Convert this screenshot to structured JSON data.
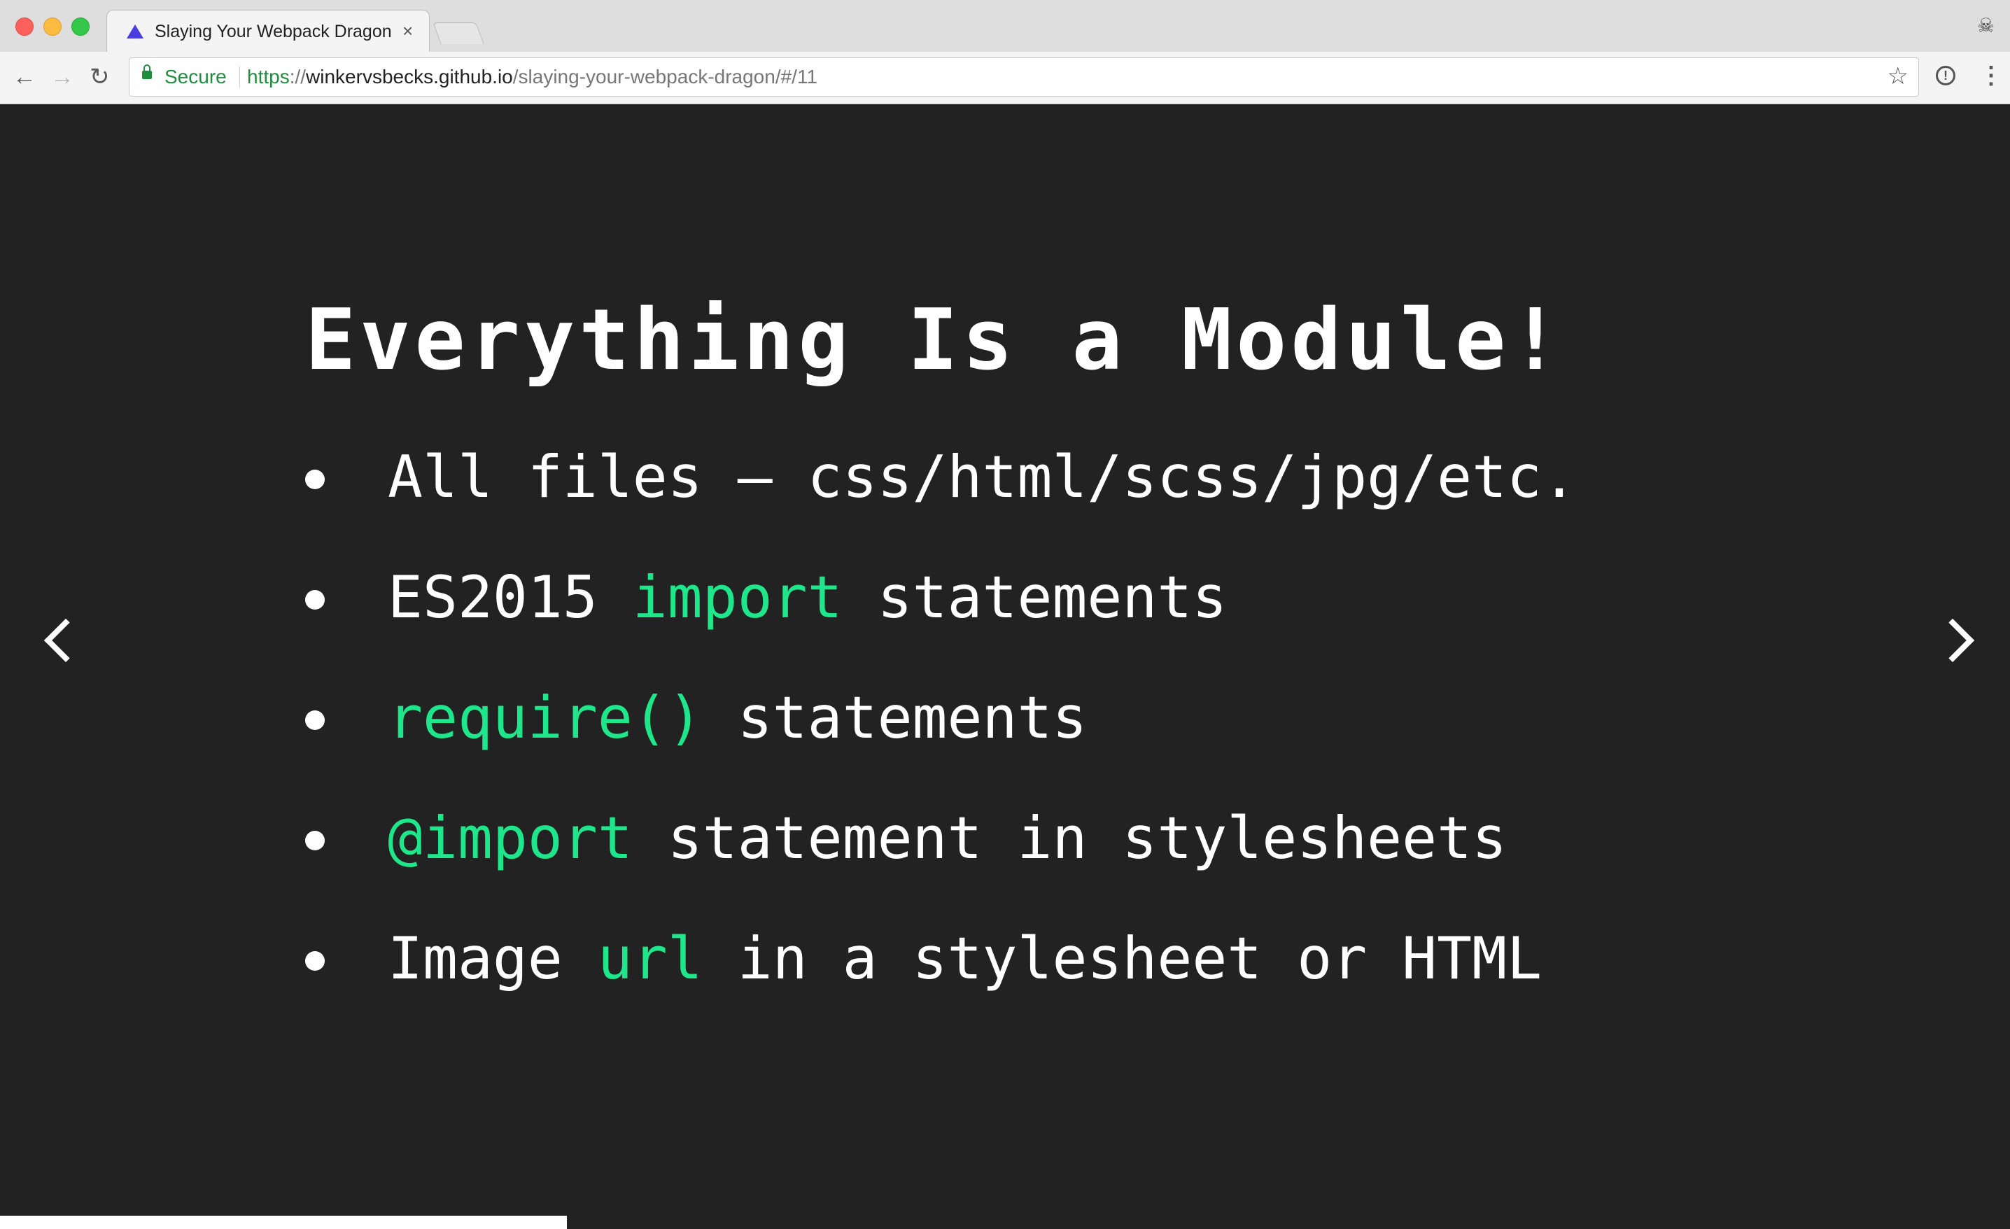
{
  "browser": {
    "tab_title": "Slaying Your Webpack Dragon",
    "tab_close": "×",
    "security_label": "Secure",
    "url": {
      "scheme": "https",
      "separator": "://",
      "host": "winkervsbecks.github.io",
      "path": "/slaying-your-webpack-dragon/#/11"
    },
    "icons": {
      "tab_favicon": "triangle-icon",
      "profile": "incognito-icon",
      "back": "arrow-left-icon",
      "forward": "arrow-right-icon",
      "reload": "reload-icon",
      "secure": "lock-icon",
      "bookmark": "star-icon",
      "extension": "info-circle-icon",
      "menu": "kebab-menu-icon"
    },
    "glyphs": {
      "back": "←",
      "forward": "→",
      "reload": "↻",
      "star": "☆",
      "extension": "!",
      "menu": "⋮",
      "profile": "☠"
    }
  },
  "slide": {
    "title": "Everything Is a Module!",
    "bullets": [
      {
        "parts": [
          "All files – css/html/scss/jpg/etc."
        ]
      },
      {
        "parts": [
          "ES2015 ",
          "import",
          " statements"
        ]
      },
      {
        "parts": [
          "require()",
          " statements"
        ]
      },
      {
        "parts": [
          "@import",
          " statement in stylesheets"
        ]
      },
      {
        "parts": [
          "Image ",
          "url",
          " in a stylesheet or HTML"
        ]
      }
    ],
    "progress_fraction": 0.282
  },
  "colors": {
    "slide_background": "#222222",
    "text": "#ffffff",
    "code_accent": "#1ee68a",
    "secure_green": "#1e8e3e",
    "favicon": "#4b3ee0"
  }
}
